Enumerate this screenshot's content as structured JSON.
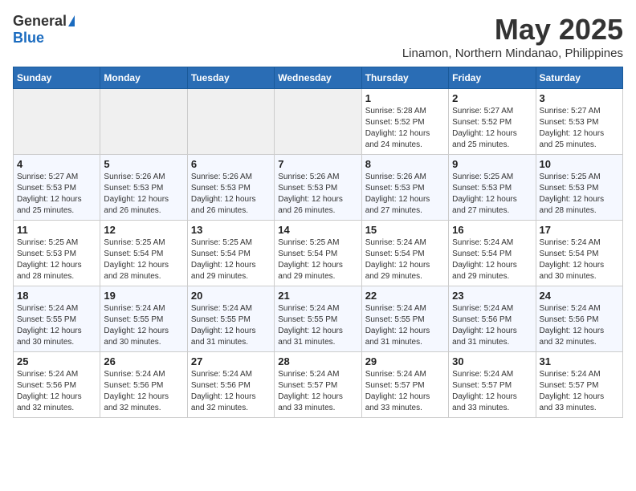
{
  "logo": {
    "general": "General",
    "blue": "Blue"
  },
  "title": {
    "month_year": "May 2025",
    "location": "Linamon, Northern Mindanao, Philippines"
  },
  "days_of_week": [
    "Sunday",
    "Monday",
    "Tuesday",
    "Wednesday",
    "Thursday",
    "Friday",
    "Saturday"
  ],
  "weeks": [
    [
      {
        "day": "",
        "info": ""
      },
      {
        "day": "",
        "info": ""
      },
      {
        "day": "",
        "info": ""
      },
      {
        "day": "",
        "info": ""
      },
      {
        "day": "1",
        "info": "Sunrise: 5:28 AM\nSunset: 5:52 PM\nDaylight: 12 hours and 24 minutes."
      },
      {
        "day": "2",
        "info": "Sunrise: 5:27 AM\nSunset: 5:52 PM\nDaylight: 12 hours and 25 minutes."
      },
      {
        "day": "3",
        "info": "Sunrise: 5:27 AM\nSunset: 5:53 PM\nDaylight: 12 hours and 25 minutes."
      }
    ],
    [
      {
        "day": "4",
        "info": "Sunrise: 5:27 AM\nSunset: 5:53 PM\nDaylight: 12 hours and 25 minutes."
      },
      {
        "day": "5",
        "info": "Sunrise: 5:26 AM\nSunset: 5:53 PM\nDaylight: 12 hours and 26 minutes."
      },
      {
        "day": "6",
        "info": "Sunrise: 5:26 AM\nSunset: 5:53 PM\nDaylight: 12 hours and 26 minutes."
      },
      {
        "day": "7",
        "info": "Sunrise: 5:26 AM\nSunset: 5:53 PM\nDaylight: 12 hours and 26 minutes."
      },
      {
        "day": "8",
        "info": "Sunrise: 5:26 AM\nSunset: 5:53 PM\nDaylight: 12 hours and 27 minutes."
      },
      {
        "day": "9",
        "info": "Sunrise: 5:25 AM\nSunset: 5:53 PM\nDaylight: 12 hours and 27 minutes."
      },
      {
        "day": "10",
        "info": "Sunrise: 5:25 AM\nSunset: 5:53 PM\nDaylight: 12 hours and 28 minutes."
      }
    ],
    [
      {
        "day": "11",
        "info": "Sunrise: 5:25 AM\nSunset: 5:53 PM\nDaylight: 12 hours and 28 minutes."
      },
      {
        "day": "12",
        "info": "Sunrise: 5:25 AM\nSunset: 5:54 PM\nDaylight: 12 hours and 28 minutes."
      },
      {
        "day": "13",
        "info": "Sunrise: 5:25 AM\nSunset: 5:54 PM\nDaylight: 12 hours and 29 minutes."
      },
      {
        "day": "14",
        "info": "Sunrise: 5:25 AM\nSunset: 5:54 PM\nDaylight: 12 hours and 29 minutes."
      },
      {
        "day": "15",
        "info": "Sunrise: 5:24 AM\nSunset: 5:54 PM\nDaylight: 12 hours and 29 minutes."
      },
      {
        "day": "16",
        "info": "Sunrise: 5:24 AM\nSunset: 5:54 PM\nDaylight: 12 hours and 29 minutes."
      },
      {
        "day": "17",
        "info": "Sunrise: 5:24 AM\nSunset: 5:54 PM\nDaylight: 12 hours and 30 minutes."
      }
    ],
    [
      {
        "day": "18",
        "info": "Sunrise: 5:24 AM\nSunset: 5:55 PM\nDaylight: 12 hours and 30 minutes."
      },
      {
        "day": "19",
        "info": "Sunrise: 5:24 AM\nSunset: 5:55 PM\nDaylight: 12 hours and 30 minutes."
      },
      {
        "day": "20",
        "info": "Sunrise: 5:24 AM\nSunset: 5:55 PM\nDaylight: 12 hours and 31 minutes."
      },
      {
        "day": "21",
        "info": "Sunrise: 5:24 AM\nSunset: 5:55 PM\nDaylight: 12 hours and 31 minutes."
      },
      {
        "day": "22",
        "info": "Sunrise: 5:24 AM\nSunset: 5:55 PM\nDaylight: 12 hours and 31 minutes."
      },
      {
        "day": "23",
        "info": "Sunrise: 5:24 AM\nSunset: 5:56 PM\nDaylight: 12 hours and 31 minutes."
      },
      {
        "day": "24",
        "info": "Sunrise: 5:24 AM\nSunset: 5:56 PM\nDaylight: 12 hours and 32 minutes."
      }
    ],
    [
      {
        "day": "25",
        "info": "Sunrise: 5:24 AM\nSunset: 5:56 PM\nDaylight: 12 hours and 32 minutes."
      },
      {
        "day": "26",
        "info": "Sunrise: 5:24 AM\nSunset: 5:56 PM\nDaylight: 12 hours and 32 minutes."
      },
      {
        "day": "27",
        "info": "Sunrise: 5:24 AM\nSunset: 5:56 PM\nDaylight: 12 hours and 32 minutes."
      },
      {
        "day": "28",
        "info": "Sunrise: 5:24 AM\nSunset: 5:57 PM\nDaylight: 12 hours and 33 minutes."
      },
      {
        "day": "29",
        "info": "Sunrise: 5:24 AM\nSunset: 5:57 PM\nDaylight: 12 hours and 33 minutes."
      },
      {
        "day": "30",
        "info": "Sunrise: 5:24 AM\nSunset: 5:57 PM\nDaylight: 12 hours and 33 minutes."
      },
      {
        "day": "31",
        "info": "Sunrise: 5:24 AM\nSunset: 5:57 PM\nDaylight: 12 hours and 33 minutes."
      }
    ]
  ]
}
